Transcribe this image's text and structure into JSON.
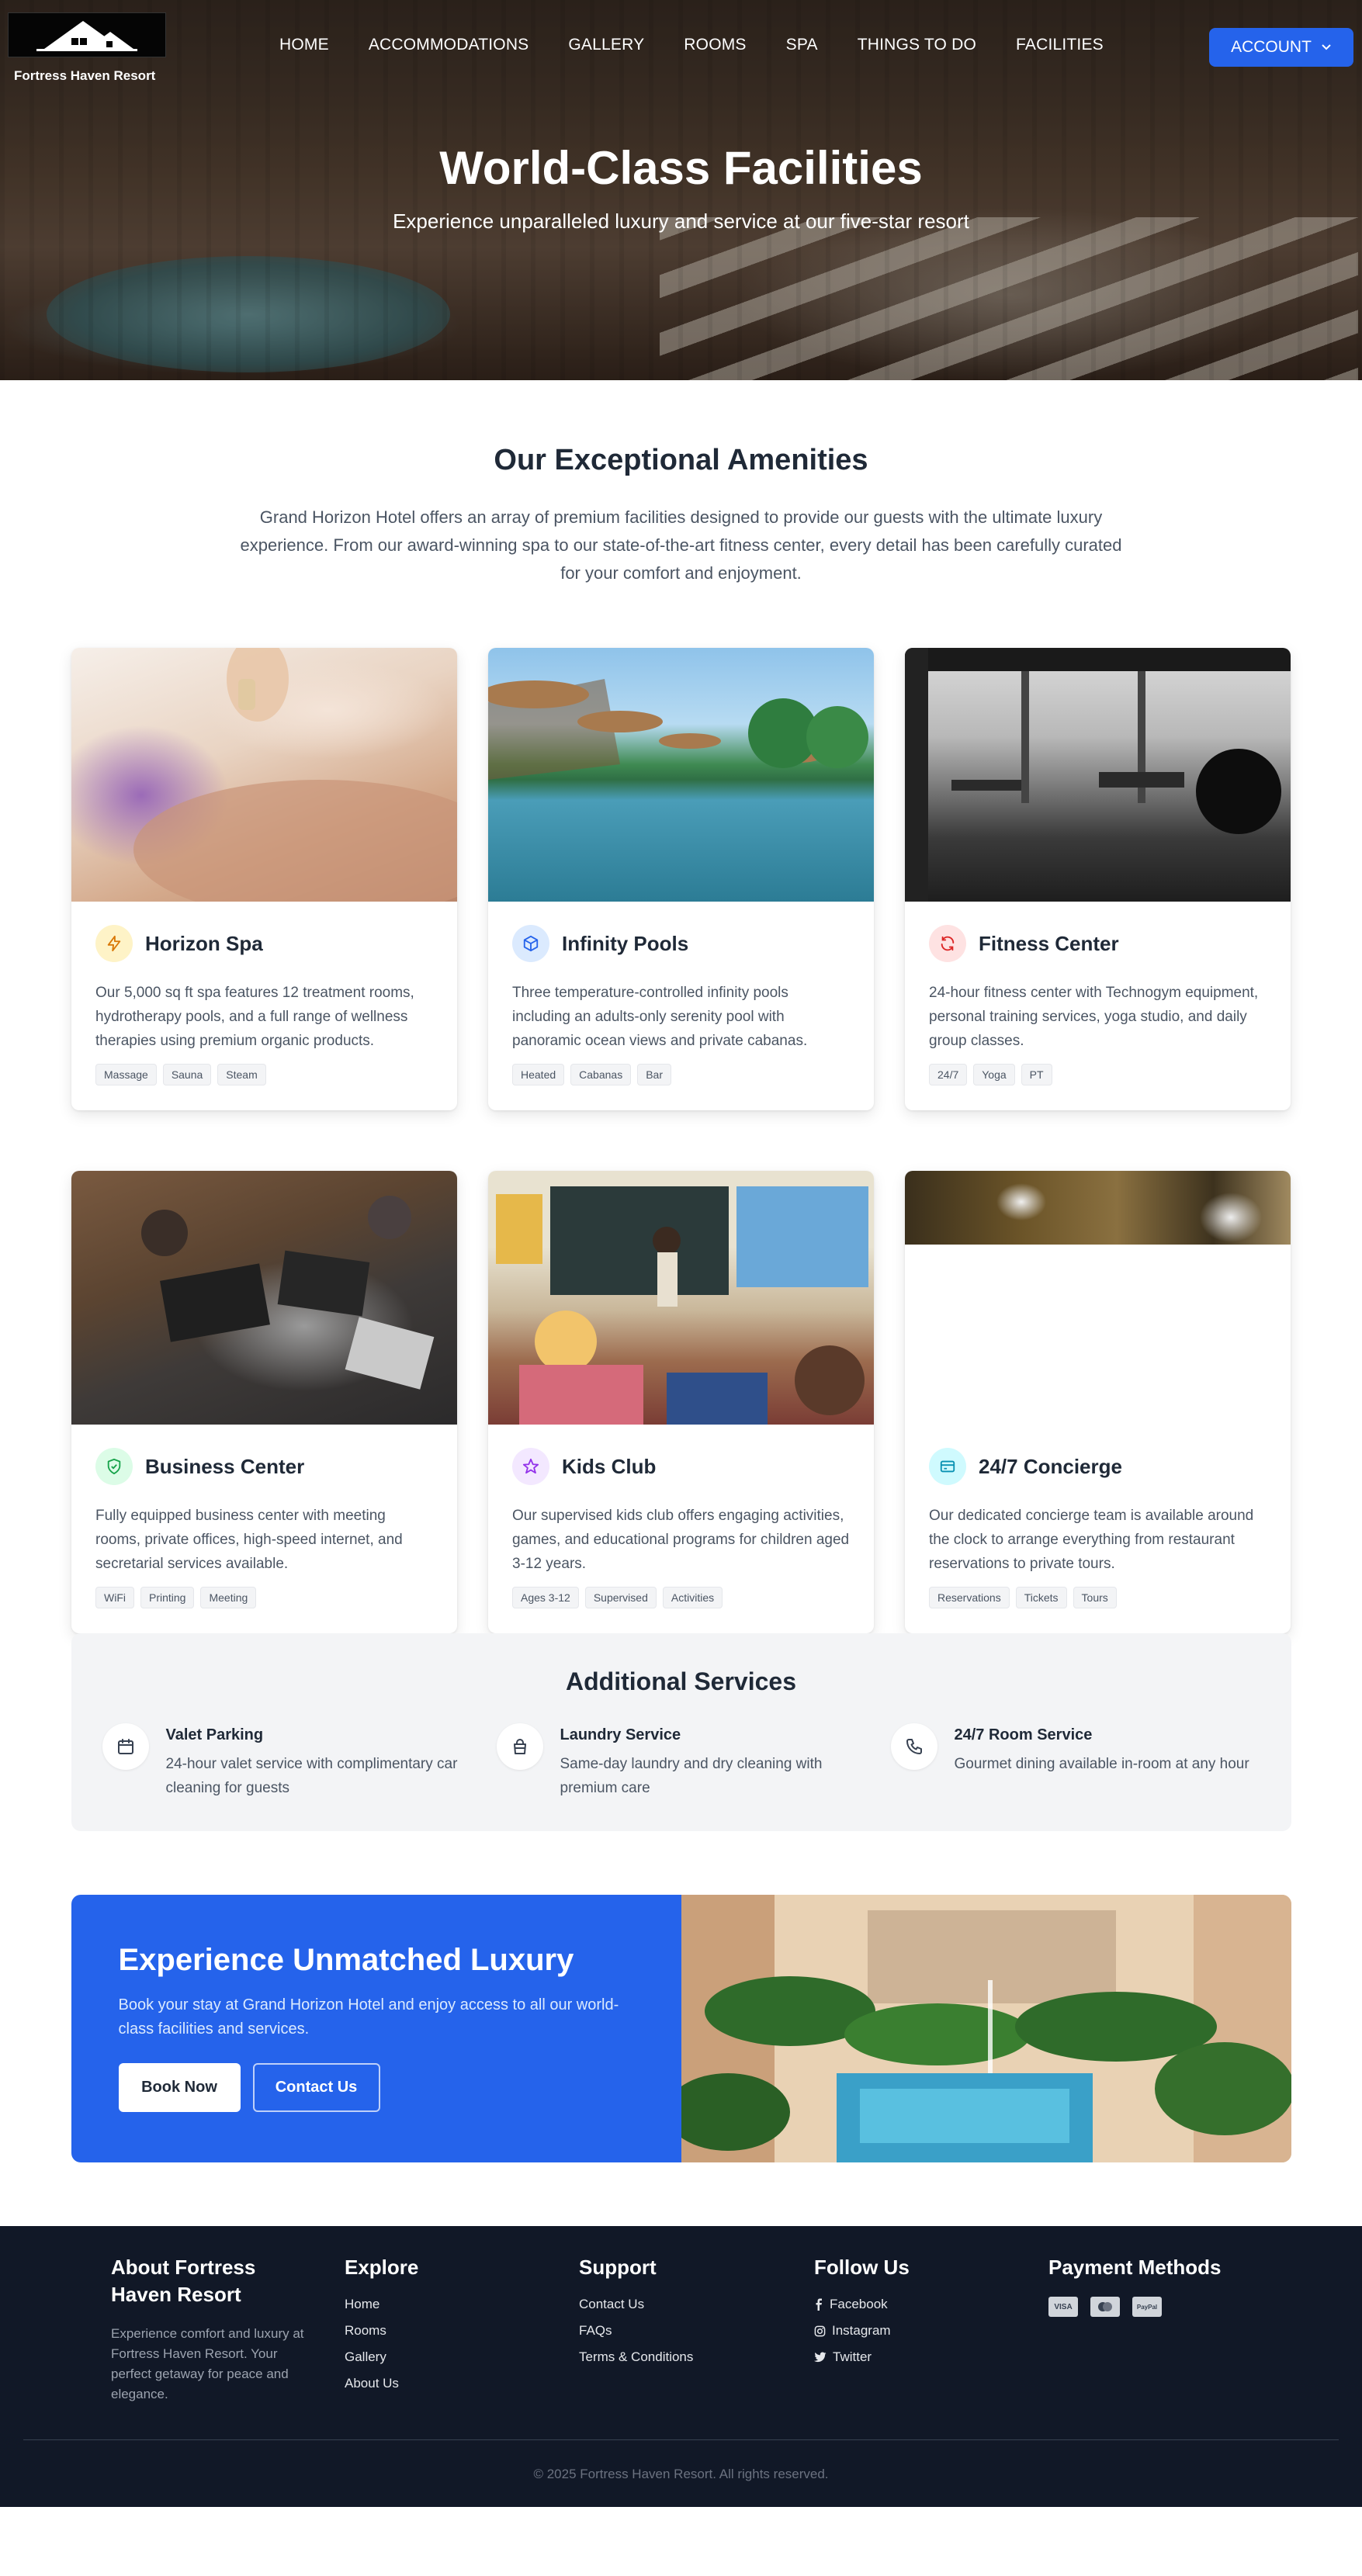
{
  "brand": {
    "name": "Fortress Haven Resort"
  },
  "nav": {
    "links": [
      "HOME",
      "ACCOMMODATIONS",
      "GALLERY",
      "ROOMS",
      "SPA",
      "THINGS TO DO",
      "FACILITIES"
    ],
    "account_label": "ACCOUNT",
    "accent": "#2563eb"
  },
  "hero": {
    "title": "World-Class Facilities",
    "subtitle": "Experience unparalleled luxury and service at our five-star resort"
  },
  "amenities": {
    "heading": "Our Exceptional Amenities",
    "intro": "Grand Horizon Hotel offers an array of premium facilities designed to provide our guests with the ultimate luxury experience. From our award-winning spa to our state-of-the-art fitness center, every detail has been carefully curated for your comfort and enjoyment.",
    "cards": [
      {
        "title": "Horizon Spa",
        "icon": "bolt-icon",
        "icon_color": "#d97706",
        "icon_bg": "#fef3c7",
        "desc": "Our 5,000 sq ft spa features 12 treatment rooms, hydrotherapy pools, and a full range of wellness therapies using premium organic products.",
        "tags": [
          "Massage",
          "Sauna",
          "Steam"
        ]
      },
      {
        "title": "Infinity Pools",
        "icon": "cube-icon",
        "icon_color": "#2563eb",
        "icon_bg": "#dbeafe",
        "desc": "Three temperature-controlled infinity pools including an adults-only serenity pool with panoramic ocean views and private cabanas.",
        "tags": [
          "Heated",
          "Cabanas",
          "Bar"
        ]
      },
      {
        "title": "Fitness Center",
        "icon": "refresh-icon",
        "icon_color": "#dc2626",
        "icon_bg": "#fee2e2",
        "desc": "24-hour fitness center with Technogym equipment, personal training services, yoga studio, and daily group classes.",
        "tags": [
          "24/7",
          "Yoga",
          "PT"
        ]
      },
      {
        "title": "Business Center",
        "icon": "shield-check-icon",
        "icon_color": "#16a34a",
        "icon_bg": "#dcfce7",
        "desc": "Fully equipped business center with meeting rooms, private offices, high-speed internet, and secretarial services available.",
        "tags": [
          "WiFi",
          "Printing",
          "Meeting"
        ]
      },
      {
        "title": "Kids Club",
        "icon": "star-icon",
        "icon_color": "#9333ea",
        "icon_bg": "#f3e8ff",
        "desc": "Our supervised kids club offers engaging activities, games, and educational programs for children aged 3-12 years.",
        "tags": [
          "Ages 3-12",
          "Supervised",
          "Activities"
        ]
      },
      {
        "title": "24/7 Concierge",
        "icon": "card-icon",
        "icon_color": "#0891b2",
        "icon_bg": "#cffafe",
        "desc": "Our dedicated concierge team is available around the clock to arrange everything from restaurant reservations to private tours.",
        "tags": [
          "Reservations",
          "Tickets",
          "Tours"
        ]
      }
    ]
  },
  "additional": {
    "heading": "Additional Services",
    "services": [
      {
        "title": "Valet Parking",
        "icon": "calendar-icon",
        "desc": "24-hour valet service with complimentary car cleaning for guests"
      },
      {
        "title": "Laundry Service",
        "icon": "bag-icon",
        "desc": "Same-day laundry and dry cleaning with premium care"
      },
      {
        "title": "24/7 Room Service",
        "icon": "phone-icon",
        "desc": "Gourmet dining available in-room at any hour"
      }
    ]
  },
  "cta": {
    "title": "Experience Unmatched Luxury",
    "text": "Book your stay at Grand Horizon Hotel and enjoy access to all our world-class facilities and services.",
    "book_label": "Book Now",
    "contact_label": "Contact Us"
  },
  "footer": {
    "about_title": "About Fortress Haven Resort",
    "about_text": "Experience comfort and luxury at Fortress Haven Resort. Your perfect getaway for peace and elegance.",
    "explore_title": "Explore",
    "explore_links": [
      "Home",
      "Rooms",
      "Gallery",
      "About Us"
    ],
    "support_title": "Support",
    "support_links": [
      "Contact Us",
      "FAQs",
      "Terms & Conditions"
    ],
    "follow_title": "Follow Us",
    "follow_links": [
      "Facebook",
      "Instagram",
      "Twitter"
    ],
    "payment_title": "Payment Methods",
    "payment_methods": [
      "VISA",
      "MC",
      "PayPal"
    ],
    "copyright": "© 2025 Fortress Haven Resort. All rights reserved."
  }
}
